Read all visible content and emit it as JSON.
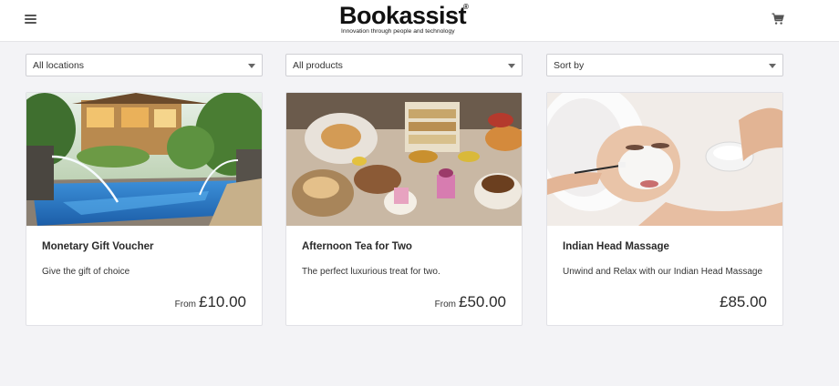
{
  "header": {
    "brand_name": "Bookassist",
    "brand_mark": "®",
    "tagline": "Innovation through people and technology",
    "menu_icon": "hamburger-menu-icon",
    "cart_icon": "shopping-cart-icon"
  },
  "filters": {
    "location": "All locations",
    "product": "All products",
    "sort": "Sort by"
  },
  "products": [
    {
      "title": "Monetary Gift Voucher",
      "description": "Give the gift of choice",
      "price_prefix": "From",
      "price": "£10.00",
      "image": "pool-with-water-fountains"
    },
    {
      "title": "Afternoon Tea for Two",
      "description": "The perfect luxurious treat for two.",
      "price_prefix": "From",
      "price": "£50.00",
      "image": "afternoon-tea-spread"
    },
    {
      "title": "Indian Head Massage",
      "description": "Unwind and Relax with our Indian Head Massage",
      "price_prefix": "",
      "price": "£85.00",
      "image": "facial-spa-treatment"
    }
  ],
  "colors": {
    "page_background": "#f3f3f6",
    "card_background": "#ffffff",
    "text": "#2a2a2a"
  }
}
